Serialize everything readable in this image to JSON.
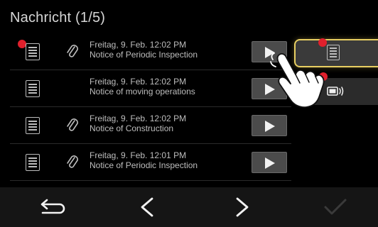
{
  "header": {
    "title": "Nachricht (1/5)"
  },
  "messages": [
    {
      "date": "Freitag, 9. Feb. 12:02 PM",
      "subject": "Notice of Periodic Inspection",
      "has_attachment": true,
      "unread": true
    },
    {
      "date": "Freitag, 9. Feb. 12:02 PM",
      "subject": "Notice of moving operations",
      "has_attachment": false,
      "unread": false
    },
    {
      "date": "Freitag, 9. Feb. 12:02 PM",
      "subject": "Notice of Construction",
      "has_attachment": true,
      "unread": false
    },
    {
      "date": "Freitag, 9. Feb. 12:01 PM",
      "subject": "Notice of Periodic Inspection",
      "has_attachment": true,
      "unread": false
    }
  ],
  "side_panel": {
    "items": [
      {
        "icon": "document-icon",
        "selected": true,
        "badge": true
      },
      {
        "icon": "battery-sound-icon",
        "selected": false,
        "badge": true
      }
    ]
  },
  "bottom_bar": {
    "buttons": [
      {
        "icon": "back-icon",
        "enabled": true
      },
      {
        "icon": "previous-icon",
        "enabled": true
      },
      {
        "icon": "next-icon",
        "enabled": true
      },
      {
        "icon": "confirm-check-icon",
        "enabled": false
      }
    ]
  },
  "colors": {
    "background": "#000000",
    "text": "#bdbdbd",
    "badge": "#e0202c",
    "selection_border": "#e8cf62",
    "play_button": "#4b4b4b",
    "disabled_icon": "#3a3a3a"
  }
}
